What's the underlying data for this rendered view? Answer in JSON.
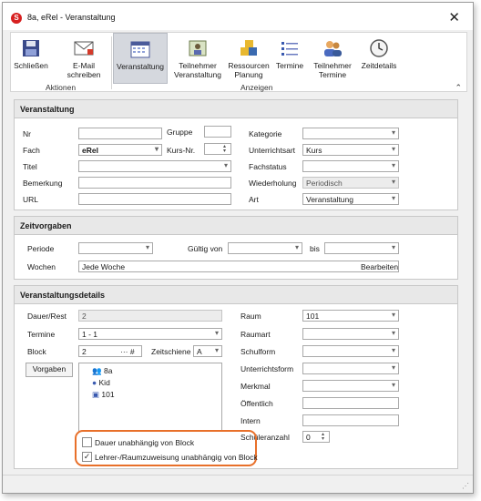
{
  "window": {
    "title": "8a, eRel - Veranstaltung",
    "app_icon_letter": "S"
  },
  "ribbon": {
    "buttons": [
      {
        "label": "Schließen",
        "icon": "save-icon"
      },
      {
        "label": "E-Mail\nschreiben",
        "icon": "email-icon"
      },
      {
        "label": "Veranstaltung",
        "icon": "calendar-icon",
        "selected": true
      },
      {
        "label": "Teilnehmer\nVeranstaltung",
        "icon": "participants-icon"
      },
      {
        "label": "Ressourcen\nPlanung",
        "icon": "resources-icon"
      },
      {
        "label": "Termine",
        "icon": "list-icon"
      },
      {
        "label": "Teilnehmer\nTermine",
        "icon": "users-icon"
      },
      {
        "label": "Zeitdetails",
        "icon": "clock-icon"
      }
    ],
    "groups": {
      "aktionen": "Aktionen",
      "anzeigen": "Anzeigen"
    }
  },
  "veranstaltung": {
    "heading": "Veranstaltung",
    "labels": {
      "nr": "Nr",
      "gruppe": "Gruppe",
      "kategorie": "Kategorie",
      "fach": "Fach",
      "kurs_nr": "Kurs-Nr.",
      "unterrichtsart": "Unterrichtsart",
      "titel": "Titel",
      "fachstatus": "Fachstatus",
      "bemerkung": "Bemerkung",
      "wiederholung": "Wiederholung",
      "url": "URL",
      "art": "Art"
    },
    "values": {
      "fach": "eRel",
      "unterrichtsart": "Kurs",
      "wiederholung": "Periodisch",
      "art": "Veranstaltung"
    }
  },
  "zeitvorgaben": {
    "heading": "Zeitvorgaben",
    "labels": {
      "periode": "Periode",
      "gueltig_von": "Gültig von",
      "bis": "bis",
      "wochen": "Wochen"
    },
    "values": {
      "wochen": "Jede Woche"
    },
    "bearbeiten": "Bearbeiten"
  },
  "details": {
    "heading": "Veranstaltungsdetails",
    "labels": {
      "dauer": "Dauer/Rest",
      "termine": "Termine",
      "block": "Block",
      "zeitschiene": "Zeitschiene",
      "raum": "Raum",
      "raumart": "Raumart",
      "schulform": "Schulform",
      "unterrichtsform": "Unterrichtsform",
      "merkmal": "Merkmal",
      "oeffentlich": "Öffentlich",
      "intern": "Intern",
      "schuelerzahl": "Schüleranzahl"
    },
    "values": {
      "dauer": "2",
      "termine": "1 - 1",
      "block": "2",
      "block_suffix": "··· #",
      "zeitschiene": "A",
      "raum": "101",
      "schuelerzahl": "0"
    },
    "vorgaben": "Vorgaben",
    "tree": [
      {
        "label": "8a",
        "icon": "class-icon"
      },
      {
        "label": "Kid",
        "icon": "teacher-icon"
      },
      {
        "label": "101",
        "icon": "room-icon"
      }
    ],
    "checkboxes": [
      {
        "label": "Dauer unabhängig von Block",
        "checked": false
      },
      {
        "label": "Lehrer-/Raumzuweisung unabhängig von Block",
        "checked": true
      }
    ],
    "check_mark": "✓"
  },
  "colors": {
    "highlight": "#e8702a",
    "selected_ribbon": "#d5d8de"
  }
}
